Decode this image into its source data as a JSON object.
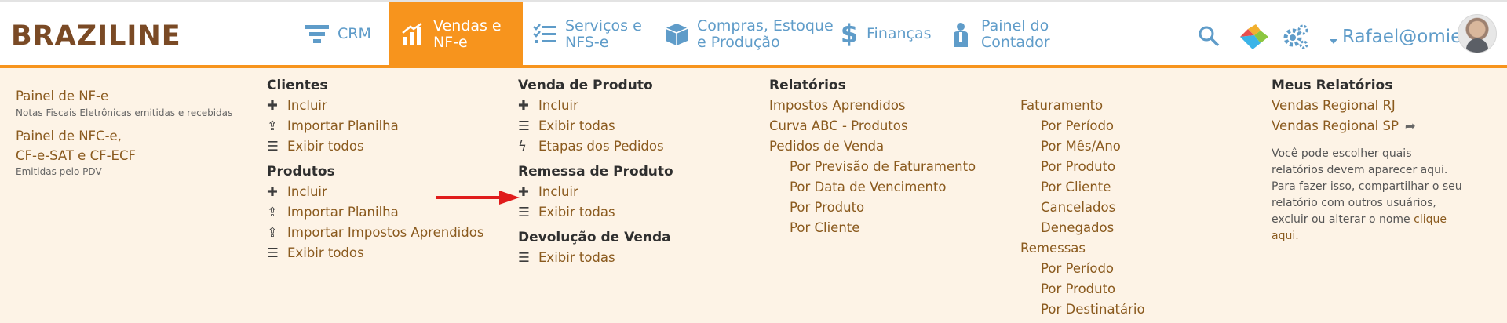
{
  "app": {
    "logo": "BRAZILINE"
  },
  "topnav": {
    "crm": "CRM",
    "vendas": [
      "Vendas e",
      "NF-e"
    ],
    "servicos": [
      "Serviços e",
      "NFS-e"
    ],
    "compras": [
      "Compras, Estoque",
      "e Produção"
    ],
    "financas": "Finanças",
    "painel": [
      "Painel do",
      "Contador"
    ]
  },
  "user": {
    "name": "Rafael@omie"
  },
  "colors": {
    "accent": "#f7941d",
    "nav_text": "#5f9cc9",
    "menu_bg": "#fdf3e6",
    "link": "#8a5a1e"
  },
  "col1": {
    "painel_nfe": "Painel de NF-e",
    "painel_nfe_desc": "Notas Fiscais Eletrônicas emitidas e recebidas",
    "painel_nfce": [
      "Painel de NFC-e,",
      "CF-e-SAT e CF-ECF"
    ],
    "painel_nfce_desc": "Emitidas pelo PDV"
  },
  "col2": {
    "clientes": {
      "title": "Clientes",
      "items": [
        "Incluir",
        "Importar Planilha",
        "Exibir todos"
      ]
    },
    "produtos": {
      "title": "Produtos",
      "items": [
        "Incluir",
        "Importar Planilha",
        "Importar Impostos Aprendidos",
        "Exibir todos"
      ]
    }
  },
  "col3": {
    "venda": {
      "title": "Venda de Produto",
      "items": [
        "Incluir",
        "Exibir todas",
        "Etapas dos Pedidos"
      ]
    },
    "remessa": {
      "title": "Remessa de Produto",
      "items": [
        "Incluir",
        "Exibir todas"
      ]
    },
    "devolucao": {
      "title": "Devolução de Venda",
      "items": [
        "Exibir todas"
      ]
    }
  },
  "col4": {
    "title": "Relatórios",
    "items": [
      "Impostos Aprendidos",
      "Curva ABC - Produtos",
      "Pedidos de Venda"
    ],
    "pedidos_sub": [
      "Por Previsão de Faturamento",
      "Por Data de Vencimento",
      "Por Produto",
      "Por Cliente"
    ]
  },
  "col5": {
    "faturamento": "Faturamento",
    "faturamento_sub": [
      "Por Período",
      "Por Mês/Ano",
      "Por Produto",
      "Por Cliente",
      "Cancelados",
      "Denegados"
    ],
    "remessas": "Remessas",
    "remessas_sub": [
      "Por Período",
      "Por Produto",
      "Por Destinatário"
    ]
  },
  "col6": {
    "title": "Meus Relatórios",
    "items": [
      "Vendas Regional RJ",
      "Vendas Regional SP"
    ],
    "note_1": "Você pode escolher quais relatórios devem aparecer aqui.",
    "note_2": "Para fazer isso, compartilhar o seu relatório com outros usuários, excluir ou alterar o nome",
    "note_link": "clique aqui."
  }
}
